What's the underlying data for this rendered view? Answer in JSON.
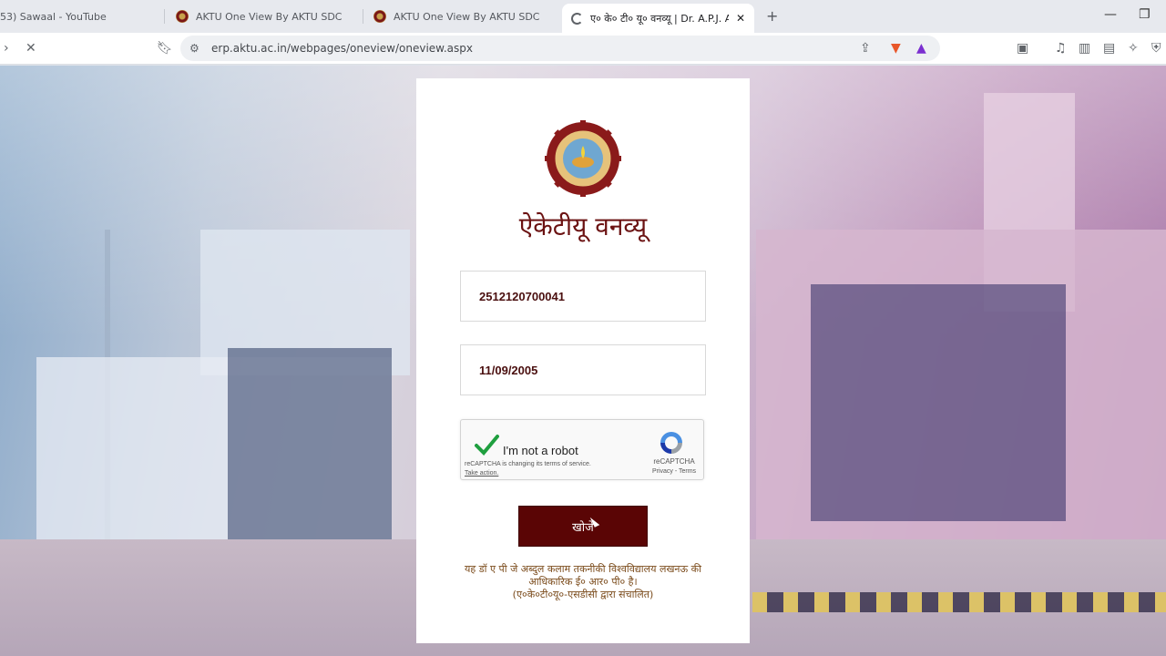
{
  "browser": {
    "tabs": [
      {
        "title": "53) Sawaal - YouTube",
        "active": false
      },
      {
        "title": "AKTU One View By AKTU SDC",
        "active": false
      },
      {
        "title": "AKTU One View By AKTU SDC",
        "active": false
      },
      {
        "title": "ए० के० टी० यू० वनव्यू | Dr. A.P.J. A",
        "active": true
      }
    ],
    "new_tab": "+",
    "url": "erp.aktu.ac.in/webpages/oneview/oneview.aspx",
    "loading": true
  },
  "page": {
    "portal_title": "ऐकेटीयू वनव्यू",
    "roll_number": "2512120700041",
    "date_of_birth": "11/09/2005",
    "captcha": {
      "label": "I'm not a robot",
      "checked": true,
      "note_line1": "reCAPTCHA is changing its terms of service.",
      "note_action": "Take action.",
      "brand": "reCAPTCHA",
      "links": "Privacy - Terms"
    },
    "search_button": "खोजें",
    "footer_line1": "यह डॉ ए पी जे अब्दुल कलाम तकनीकी विश्वविद्यालय लखनऊ की",
    "footer_line2": "आधिकारिक ई० आर० पी० है।",
    "footer_line3": "(ए०के०टी०यू०-एसडीसी द्वारा संचालित)"
  },
  "colors": {
    "brand_maroon": "#5a0505",
    "title_maroon": "#6b1212",
    "captcha_check": "#1f9f3f"
  }
}
